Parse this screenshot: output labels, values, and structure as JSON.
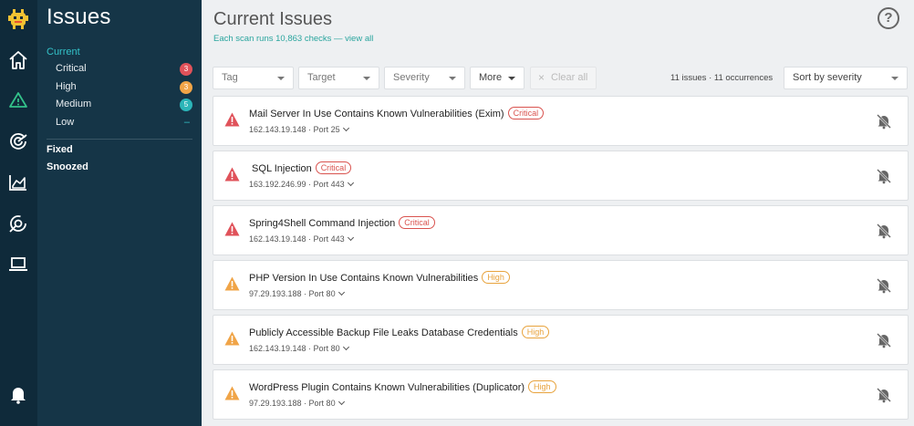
{
  "sidebar": {
    "title": "Issues",
    "current_label": "Current",
    "severity_items": [
      {
        "label": "Critical",
        "count": "3",
        "color": "#e0525a"
      },
      {
        "label": "High",
        "count": "3",
        "color": "#f0a447"
      },
      {
        "label": "Medium",
        "count": "5",
        "color": "#2bb5b8"
      },
      {
        "label": "Low",
        "count": "–",
        "color": ""
      }
    ],
    "fixed_label": "Fixed",
    "snoozed_label": "Snoozed"
  },
  "rail": {
    "icons": [
      "monster-logo-icon",
      "home-icon",
      "warning-icon",
      "target-icon",
      "chart-icon",
      "radar-icon",
      "laptop-icon",
      "bell-icon"
    ]
  },
  "main": {
    "title": "Current Issues",
    "subtitle_prefix": "Each scan runs 10,863 checks — ",
    "subtitle_link": "view all",
    "help_glyph": "?",
    "filters": {
      "tag": "Tag",
      "target": "Target",
      "severity": "Severity",
      "more": "More",
      "clear_all": "Clear all"
    },
    "counts": "11 issues · 11 occurrences",
    "sort": "Sort by severity",
    "issues": [
      {
        "title": "Mail Server In Use Contains Known Vulnerabilities (Exim)",
        "severity": "Critical",
        "meta": "162.143.19.148 · Port 25"
      },
      {
        "title": " SQL Injection",
        "severity": "Critical",
        "meta": "163.192.246.99 · Port 443"
      },
      {
        "title": "Spring4Shell Command Injection",
        "severity": "Critical",
        "meta": "162.143.19.148 · Port 443"
      },
      {
        "title": "PHP Version In Use Contains Known Vulnerabilities",
        "severity": "High",
        "meta": "97.29.193.188 · Port 80"
      },
      {
        "title": "Publicly Accessible Backup File Leaks Database Credentials",
        "severity": "High",
        "meta": "162.143.19.148 · Port 80"
      },
      {
        "title": "WordPress Plugin Contains Known Vulnerabilities (Duplicator)",
        "severity": "High",
        "meta": "97.29.193.188 · Port 80"
      }
    ]
  },
  "colors": {
    "critical": "#d9534f",
    "high": "#f0a447",
    "accent": "#2aa59e",
    "sidebar_bg": "#153547",
    "rail_bg": "#0f2a3a"
  }
}
